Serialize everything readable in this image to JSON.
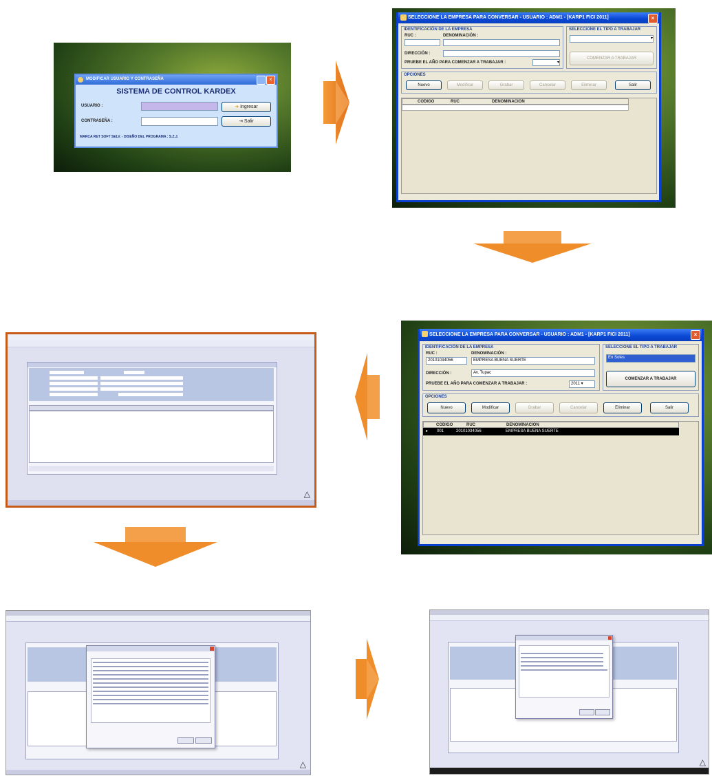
{
  "login": {
    "title": "MODIFICAR USUARIO Y CONTRASEÑA",
    "heading": "SISTEMA DE CONTROL KARDEX",
    "usuario_label": "USUARIO :",
    "contrasena_label": "CONTRASEÑA :",
    "ingresar_label": "Ingresar",
    "salir_label": "Salir",
    "footer": "MARCA RET SOFT SELV. - DISEÑO DEL PROGRAMA : S.Z.J."
  },
  "select_empty": {
    "title": "SELECCIONE LA EMPRESA PARA CONVERSAR - USUARIO : ADM1 - [KARP1 FICI 2011]",
    "group_empresa": "IDENTIFICACIÓN DE LA EMPRESA",
    "ruc_label": "RUC :",
    "denominacion_label": "DENOMINACIÓN :",
    "direccion_label": "DIRECCIÓN :",
    "anio_label": "PRUEBE EL AÑO PARA COMENZAR A TRABAJAR :",
    "group_tipo": "SELECCIONE EL TIPO A TRABAJAR",
    "comenzar_label": "COMENZAR A TRABAJAR",
    "group_opciones": "OPCIONES",
    "nuevo_label": "Nuevo",
    "modificar_label": "Modificar",
    "grabar_label": "Grabar",
    "cancelar_label": "Cancelar",
    "eliminar_label": "Eliminar",
    "salir_label": "Salir",
    "col_codigo": "CODIGO",
    "col_ruc": "RUC",
    "col_denominacion": "DENOMINACION"
  },
  "select_filled": {
    "title": "SELECCIONE LA EMPRESA PARA CONVERSAR - USUARIO : ADM1 - [KARP1 FICI 2011]",
    "group_empresa": "IDENTIFICACIÓN DE LA EMPRESA",
    "ruc_label": "RUC :",
    "ruc_value": "20101034056",
    "denominacion_label": "DENOMINACIÓN :",
    "denominacion_value": "EMPRESA BUENA SUERTE",
    "direccion_label": "DIRECCIÓN :",
    "direccion_value": "Av. Tupac",
    "anio_label": "PRUEBE EL AÑO PARA COMENZAR A TRABAJAR :",
    "anio_value": "2011",
    "group_tipo": "SELECCIONE EL TIPO A TRABAJAR",
    "tipo_value": "En Soles",
    "comenzar_label": "COMENZAR A TRABAJAR",
    "group_opciones": "OPCIONES",
    "nuevo_label": "Nuevo",
    "modificar_label": "Modificar",
    "grabar_label": "Grabar",
    "cancelar_label": "Cancelar",
    "eliminar_label": "Eliminar",
    "salir_label": "Salir",
    "col_codigo": "CODIGO",
    "col_ruc": "RUC",
    "col_denominacion": "DENOMINACION",
    "row_codigo": "001",
    "row_ruc": "20101034056",
    "row_denominacion": "EMPRESA BUENA SUERTE"
  },
  "colors": {
    "arrow_orange": "#f0902c",
    "arrow_light": "#fbc17a",
    "xp_blue": "#0a48d4",
    "grid_selected": "#000000"
  },
  "icons": [
    "key-icon",
    "close-icon",
    "arrow-right-icon",
    "arrow-down-icon",
    "arrow-left-icon"
  ]
}
